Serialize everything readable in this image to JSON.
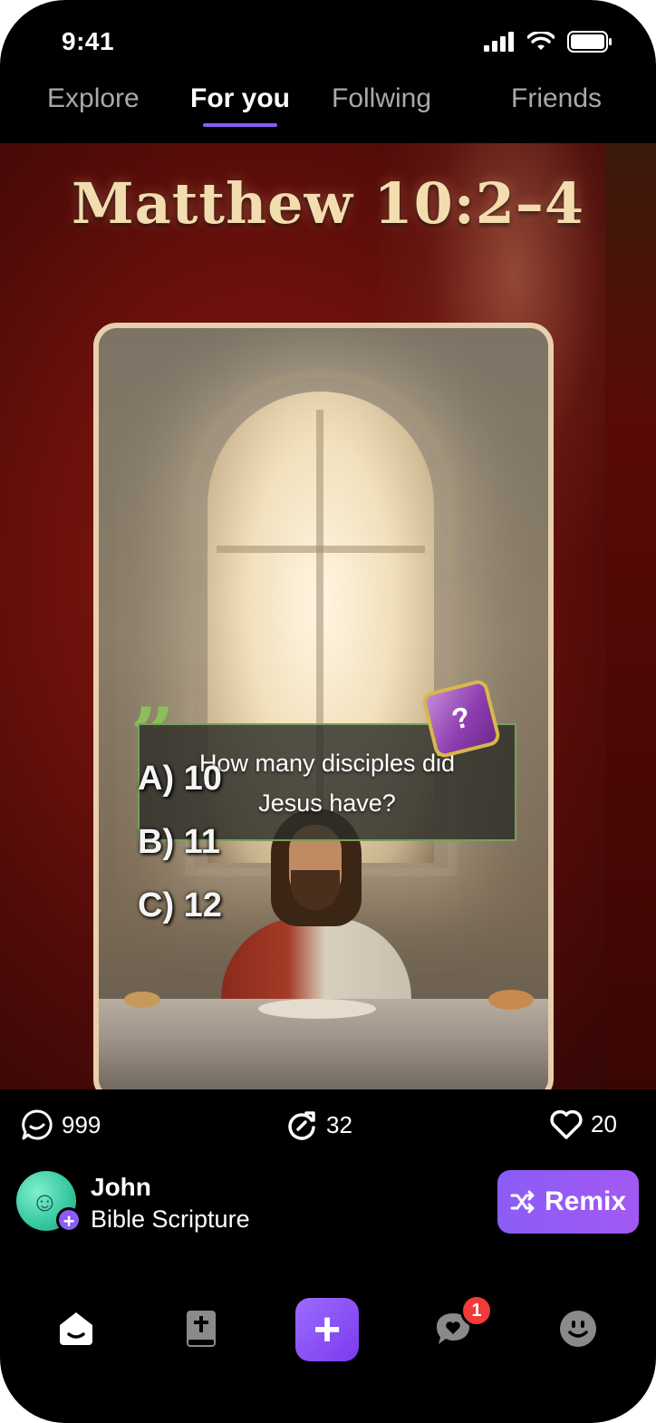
{
  "status_bar": {
    "time": "9:41",
    "icons": [
      "signal-icon",
      "wifi-icon",
      "battery-icon"
    ]
  },
  "top_tabs": [
    {
      "label": "Explore",
      "active": false
    },
    {
      "label": "For you",
      "active": true
    },
    {
      "label": "Follwing",
      "active": false
    },
    {
      "label": "Friends",
      "active": false
    }
  ],
  "post": {
    "headline": "Matthew 10:2–4",
    "question_line1": "How many disciples did",
    "question_line2": "Jesus have?",
    "dice_glyph": "?",
    "answers": [
      "A) 10",
      "B) 11",
      "C) 12"
    ]
  },
  "actions": {
    "comments": "999",
    "shares": "32",
    "likes": "20"
  },
  "author": {
    "name": "John",
    "subtitle": "Bible Scripture",
    "follow_glyph": "+"
  },
  "remix_label": "Remix",
  "bottom_nav": {
    "items": [
      "home-icon",
      "bible-icon",
      "create-icon",
      "messages-icon",
      "profile-icon"
    ],
    "create_glyph": "+",
    "messages_badge": "1"
  },
  "colors": {
    "accent": "#8b5cf6",
    "badge": "#f33a3a",
    "headline": "#f3ddb0"
  }
}
